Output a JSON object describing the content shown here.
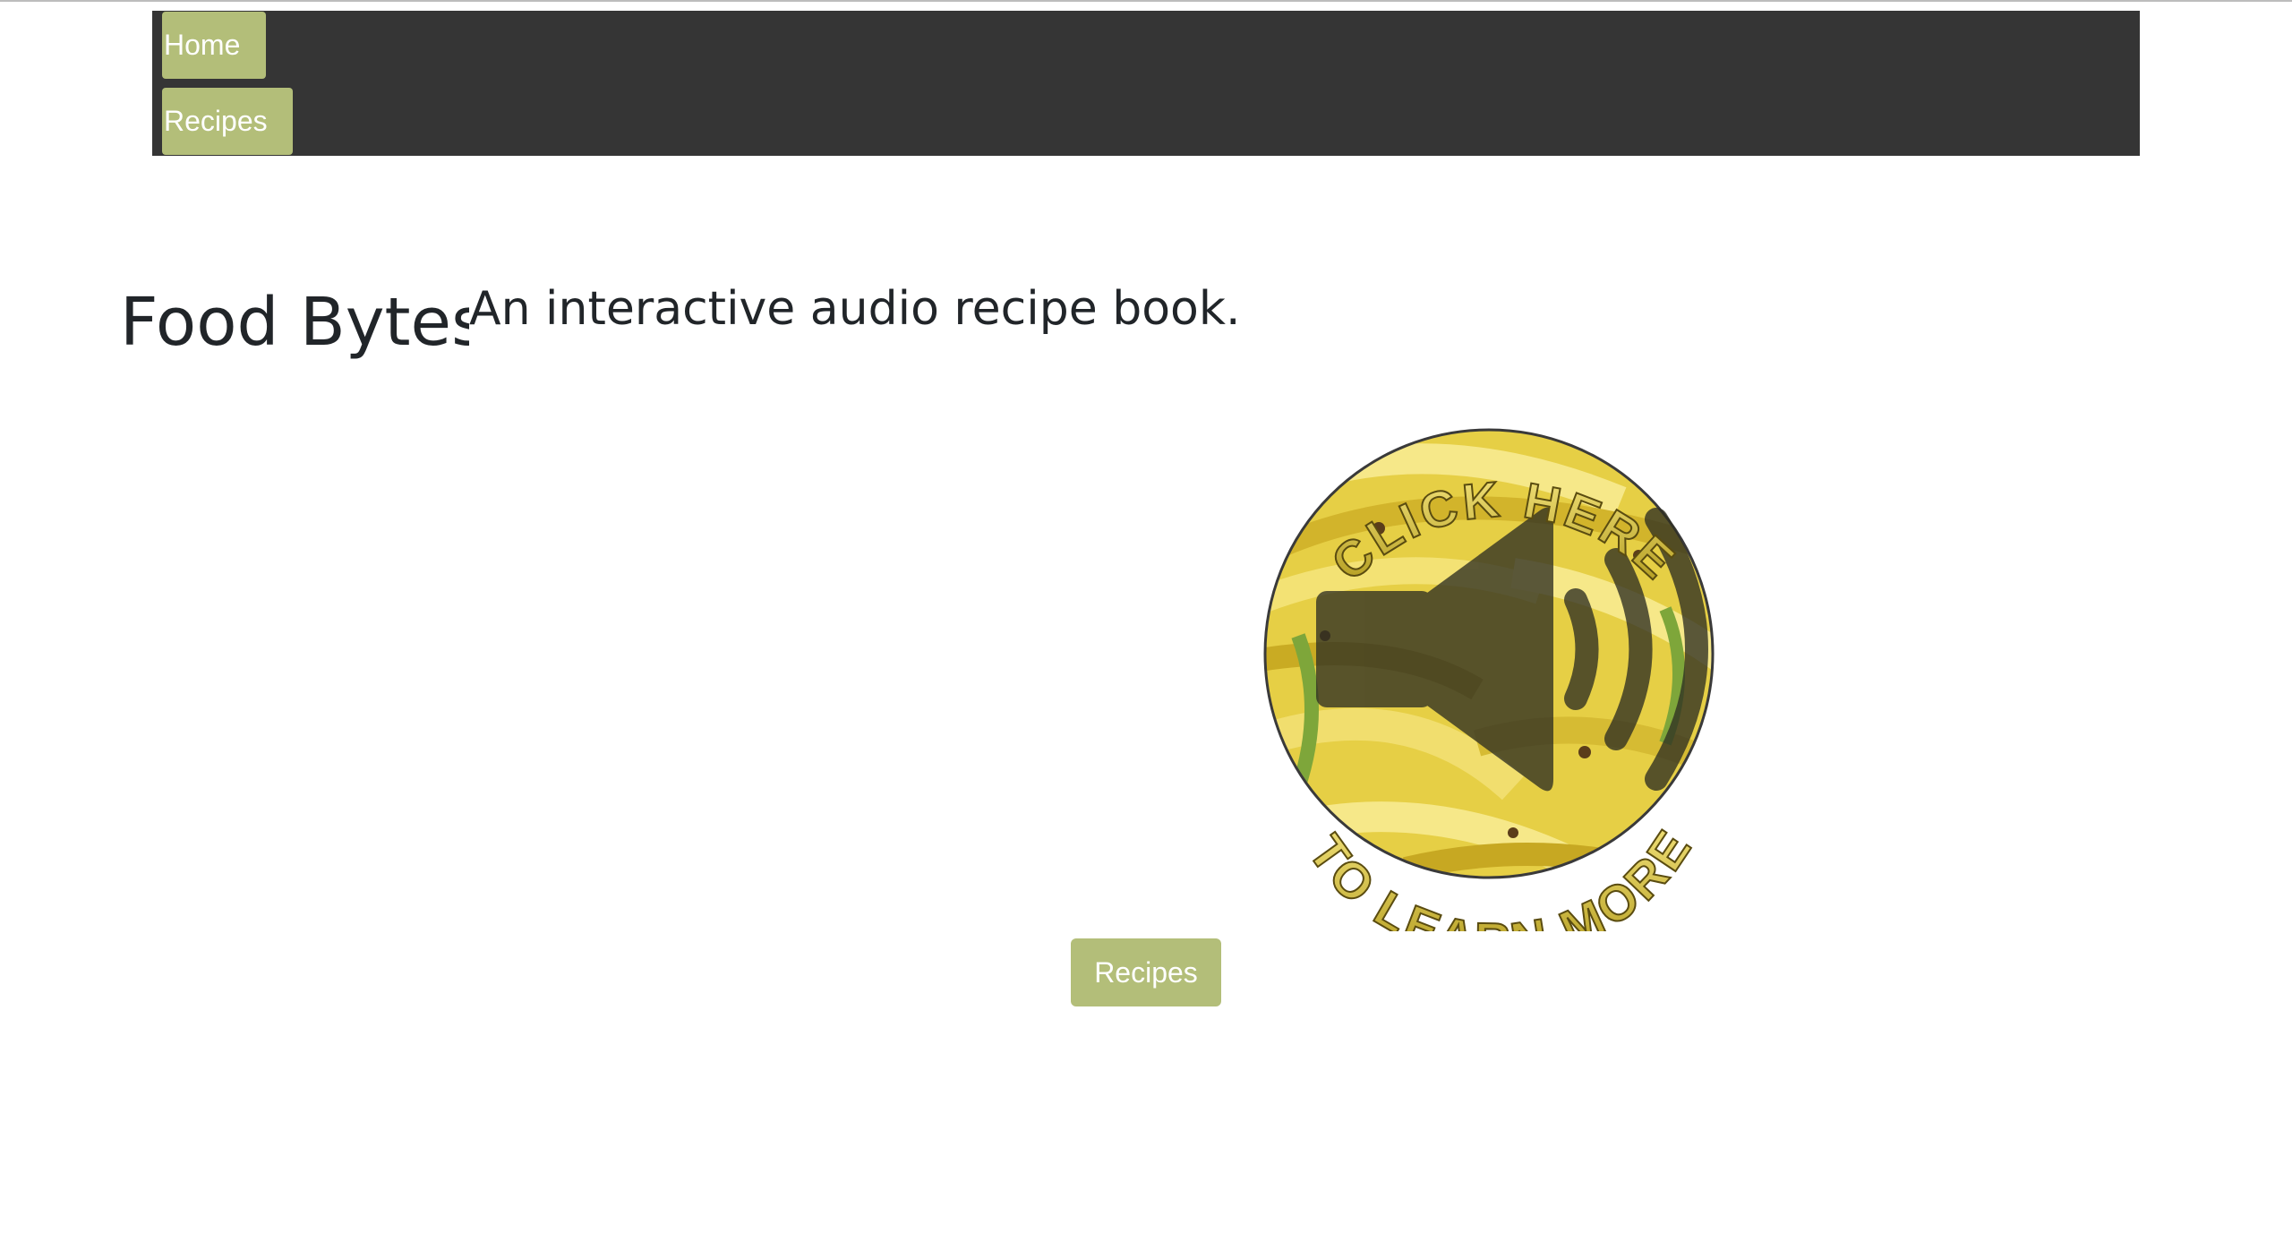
{
  "nav": {
    "home_label": "Home",
    "recipes_label": "Recipes"
  },
  "hero": {
    "title": "Food Bytes",
    "subtitle": "An interactive audio recipe book."
  },
  "audio_badge": {
    "top_text": "CLICK HERE",
    "bottom_text": "TO LEARN MORE",
    "icon": "speaker-icon"
  },
  "cta": {
    "recipes_label": "Recipes"
  },
  "colors": {
    "navbar_bg": "#353535",
    "button_bg": "#b3be79",
    "button_text": "#ffffff",
    "text": "#212529",
    "badge_yellow": "#e8d44d"
  }
}
